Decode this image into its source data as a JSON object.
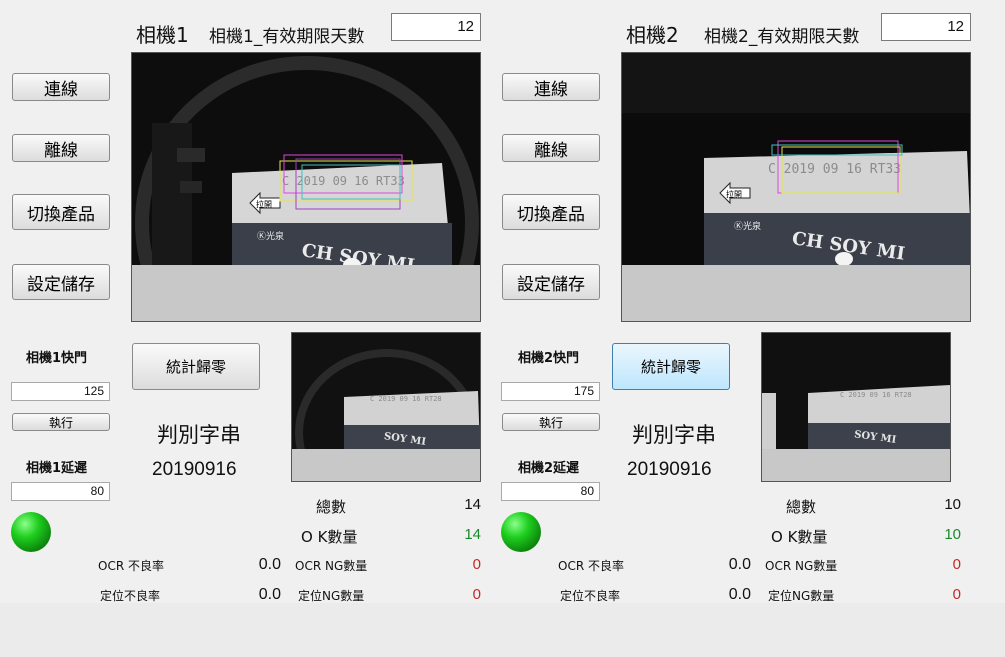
{
  "cameras": [
    {
      "title": "相機1",
      "days_label": "相機1_有效期限天數",
      "days_value": "12",
      "connect": "連線",
      "disconnect": "離線",
      "switch_product": "切換產品",
      "save_settings": "設定儲存",
      "shutter_label": "相機1快門",
      "shutter_value": "125",
      "execute": "執行",
      "delay_label": "相機1延遲",
      "delay_value": "80",
      "reset_stats": "統計歸零",
      "judge_label": "判別字串",
      "judge_value": "20190916",
      "total_label": "總數",
      "total_value": "14",
      "ok_label": "O K數量",
      "ok_value": "14",
      "ocr_rate_label": "OCR 不良率",
      "ocr_rate_value": "0.0",
      "ocr_ng_label": "OCR NG數量",
      "ocr_ng_value": "0",
      "pos_rate_label": "定位不良率",
      "pos_rate_value": "0.0",
      "pos_ng_label": "定位NG數量",
      "pos_ng_value": "0",
      "image_text": "C 2019 09 16 RT33",
      "ok_color": "#1b8a2a",
      "ng_color": "#c62828",
      "status_color": "#1fcf1f"
    },
    {
      "title": "相機2",
      "days_label": "相機2_有效期限天數",
      "days_value": "12",
      "connect": "連線",
      "disconnect": "離線",
      "switch_product": "切換產品",
      "save_settings": "設定儲存",
      "shutter_label": "相機2快門",
      "shutter_value": "175",
      "execute": "執行",
      "delay_label": "相機2延遲",
      "delay_value": "80",
      "reset_stats": "統計歸零",
      "judge_label": "判別字串",
      "judge_value": "20190916",
      "total_label": "總數",
      "total_value": "10",
      "ok_label": "O K數量",
      "ok_value": "10",
      "ocr_rate_label": "OCR 不良率",
      "ocr_rate_value": "0.0",
      "ocr_ng_label": "OCR NG數量",
      "ocr_ng_value": "0",
      "pos_rate_label": "定位不良率",
      "pos_rate_value": "0.0",
      "pos_ng_label": "定位NG數量",
      "pos_ng_value": "0",
      "image_text": "C 2019 09 16 RT33",
      "ok_color": "#1b8a2a",
      "ng_color": "#c62828",
      "status_color": "#1fcf1f"
    }
  ]
}
